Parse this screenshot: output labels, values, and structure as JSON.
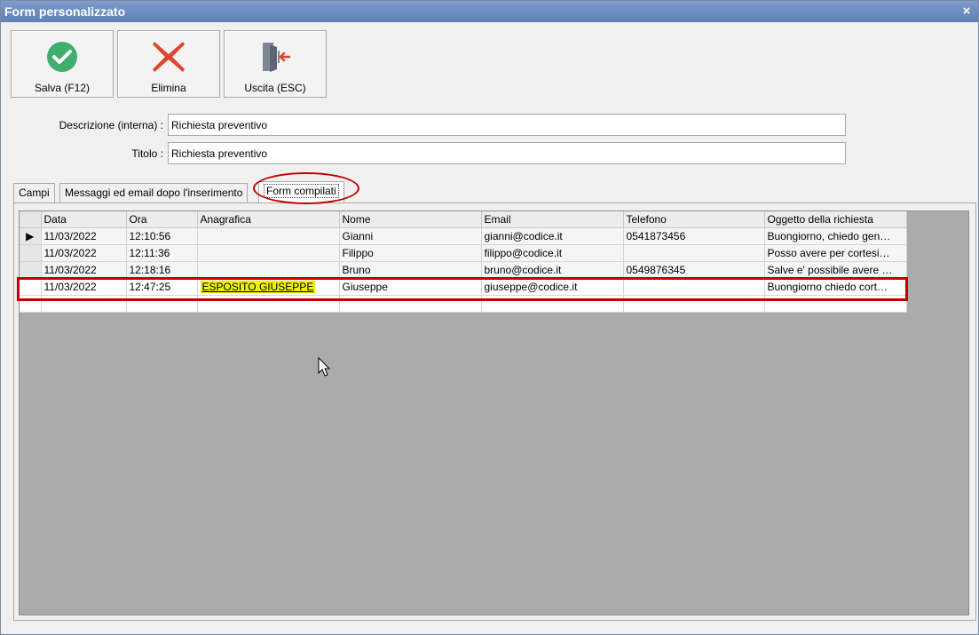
{
  "window": {
    "title": "Form personalizzato",
    "close": "×"
  },
  "toolbar": {
    "save_label": "Salva (F12)",
    "delete_label": "Elimina",
    "exit_label": "Uscita (ESC)"
  },
  "form": {
    "descrizione_label": "Descrizione (interna) :",
    "descrizione_value": "Richiesta preventivo",
    "titolo_label": "Titolo :",
    "titolo_value": "Richiesta preventivo"
  },
  "tabs": [
    {
      "label": "Campi"
    },
    {
      "label": "Messaggi ed email dopo l'inserimento"
    },
    {
      "label": "Form compilati"
    }
  ],
  "grid": {
    "columns": [
      "Data",
      "Ora",
      "Anagrafica",
      "Nome",
      "Email",
      "Telefono",
      "Oggetto della richiesta"
    ],
    "rows": [
      [
        "11/03/2022",
        "12:10:56",
        "",
        "Gianni",
        "gianni@codice.it",
        "0541873456",
        "Buongiorno, chiedo gen…"
      ],
      [
        "11/03/2022",
        "12:11:36",
        "",
        "Filippo",
        "filippo@codice.it",
        "",
        "Posso avere per cortesi…"
      ],
      [
        "11/03/2022",
        "12:18:16",
        "",
        "Bruno",
        "bruno@codice.it",
        "0549876345",
        "Salve e' possibile avere …"
      ],
      [
        "11/03/2022",
        "12:47:25",
        "ESPOSITO GIUSEPPE",
        "Giuseppe",
        "giuseppe@codice.it",
        "",
        "Buongiorno chiedo cort…"
      ]
    ],
    "current_row_marker": "▶"
  },
  "colors": {
    "titlebar": "#6c8cbd",
    "highlight": "#f2f200",
    "annotation": "#c00000"
  }
}
